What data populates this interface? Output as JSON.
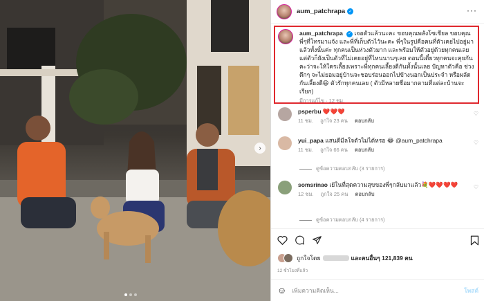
{
  "post": {
    "username": "aum_patchrapa",
    "verified": true
  },
  "caption": {
    "username": "aum_patchrapa",
    "text": "เจอตัวแล้วนะคะ ขอบคุณพลังโซเชียล ขอบคุณพี่ๆที่โทรมาแจ้ง และพี่ที่เก็บตัวไว้นะคะ พี่ๆในรูปคือคนที่ตัวเคยไปอยู่มาแล้วทั้งนั้นค่ะ ทุกคนเป็นห่วงตัวมาก และพร้อมให้ตัวอยู่ด้วยทุกคนเลย แต่ตัวก็ยังเป็นตัวที่ไม่เคยอยู่ที่ไหนนานๆเลย ตอนนี้เดี๋ยวทุกคนจะคุยกันคะว่าจะให้ใครเลี้ยงเพราะพี่ทุกคนเลี้ยงดีกันทั้งนั้นเลย ปัญหาตัวคือ ช่วงดึกๆ จะไม่ยอมอยู่บ้านจะชอบร่อนออกไปข้างนอกเป็นประจำ หรือผลัดกันเลี้ยงดี😆 ตัวรักทุกคนเลย ( ตัวมีหลายชื่อมากตามที่แต่ละบ้านจะเรียก)",
    "meta": "มีการแก้ไข · 12 ชม."
  },
  "comments": [
    {
      "username": "psperbu",
      "text": "❤️❤️❤️",
      "time": "11 ชม.",
      "likes": "ถูกใจ 23 คน",
      "reply": "ตอบกลับ"
    },
    {
      "username": "yui_papa",
      "text": "แสนดีมีลใจตัวไม่ได้หรอ 😂 @aum_patchrapa",
      "time": "11 ชม.",
      "likes": "ถูกใจ 66 คน",
      "reply": "ตอบกลับ",
      "view_replies": "ดูข้อความตอบกลับ (3 รายการ)"
    },
    {
      "username": "somsrinao",
      "text": "เย้ในที่สุดความสุขของพี่ๆกลับมาแล้ว💐❤️❤️❤️❤️",
      "time": "12 ชม.",
      "likes": "ถูกใจ 25 คน",
      "reply": "ตอบกลับ",
      "view_replies": "ดูข้อความตอบกลับ (4 รายการ)"
    }
  ],
  "likes_line": {
    "prefix": "ถูกใจโดย",
    "suffix": "และคนอื่นๆ 121,839 คน"
  },
  "post_time": "12 ชั่วโมงที่แล้ว",
  "composer": {
    "placeholder": "เพิ่มความคิดเห็น...",
    "post_label": "โพสต์"
  },
  "carousel": {
    "total": 3,
    "active": 1
  },
  "icons": [
    "more-icon",
    "heart-icon",
    "comment-icon",
    "share-icon",
    "bookmark-icon",
    "emoji-icon",
    "chevron-right-icon",
    "verified-icon"
  ],
  "colors": {
    "highlight_border": "#e0282e",
    "verified": "#0095f6",
    "muted_text": "#8e8e8e",
    "post_button": "#b2dffc"
  }
}
